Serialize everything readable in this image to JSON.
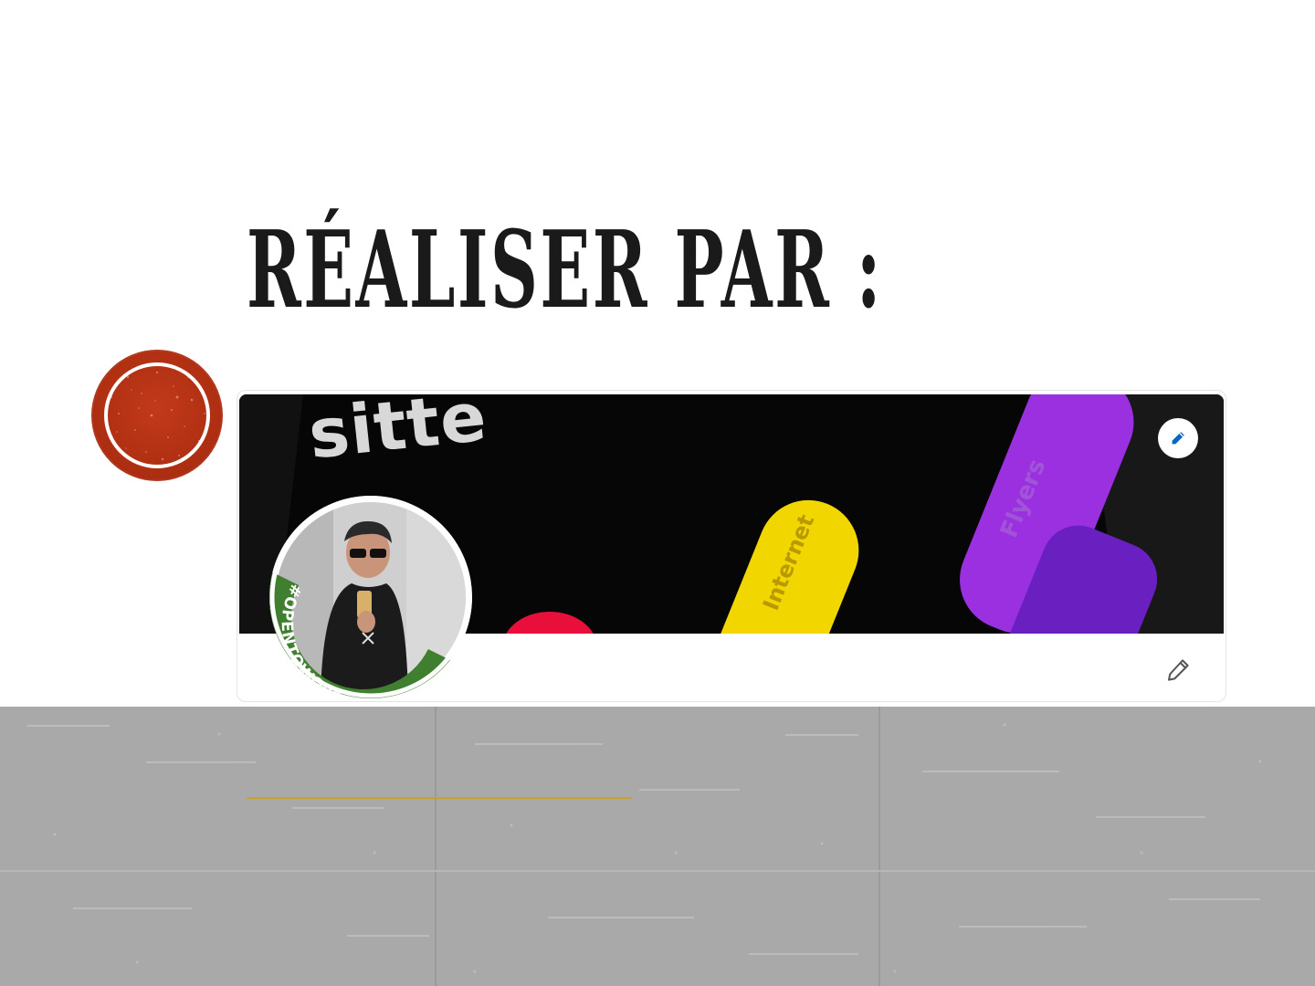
{
  "slide": {
    "title": "RÉALISER PAR :"
  },
  "profile_card": {
    "banner_text": "sitte",
    "pill_labels": {
      "internet": "Internet",
      "flyers": "Flyers"
    },
    "avatar_badge_text": "#OPENTOWORK",
    "icons": {
      "banner_edit": "pencil-icon",
      "profile_edit": "pencil-icon"
    }
  },
  "colors": {
    "title": "#1a1a1a",
    "badge_red": "#b02f12",
    "banner_bg": "#070707",
    "pill_yellow": "#f2d600",
    "pill_purple": "#9b30e0",
    "pill_red": "#e8103a",
    "open_to_work_green": "#3f7f2f",
    "edit_blue": "#0a66c2",
    "band_gray": "#aaaaaa",
    "gold_line": "#c9a227"
  }
}
